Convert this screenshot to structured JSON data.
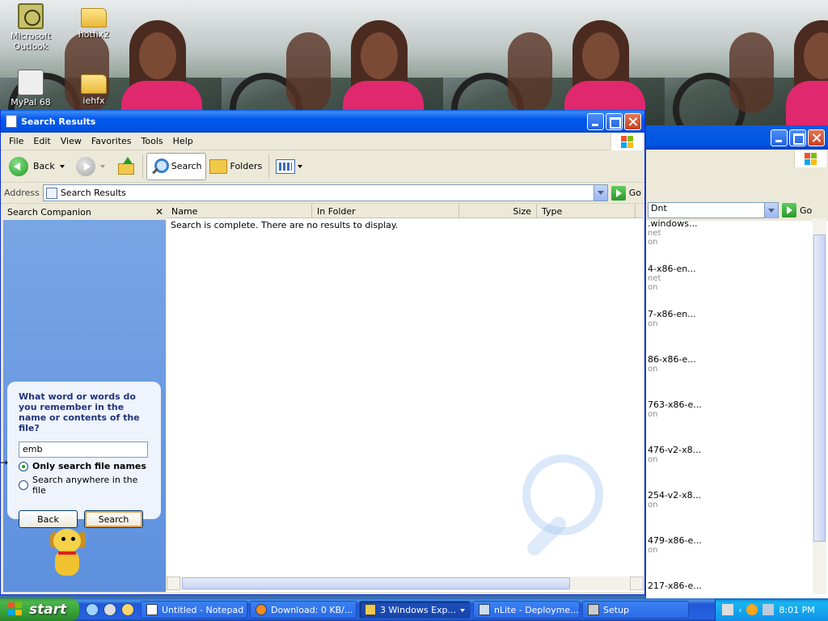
{
  "desktop": {
    "icons": [
      {
        "label": "Microsoft Outlook",
        "icon": "outlook-icon"
      },
      {
        "label": "hotfix2",
        "icon": "folder-icon"
      },
      {
        "label": "MyPal 68",
        "icon": "mypal-shortcut-icon"
      },
      {
        "label": "iehfx",
        "icon": "folder-icon"
      }
    ]
  },
  "window": {
    "title": "Search Results",
    "menu": [
      "File",
      "Edit",
      "View",
      "Favorites",
      "Tools",
      "Help"
    ],
    "toolbar": {
      "back_label": "Back",
      "search_label": "Search",
      "folders_label": "Folders"
    },
    "address": {
      "label": "Address",
      "value": "Search Results",
      "go_label": "Go"
    },
    "companion": {
      "title": "Search Companion",
      "question": "What word or words do you remember in the name or contents of the file?",
      "search_value": "emb",
      "option_1": "Only search file names",
      "option_2": "Search anywhere in the file",
      "back_label": "Back",
      "search_label": "Search"
    },
    "results": {
      "columns": [
        "Name",
        "In Folder",
        "Size",
        "Type"
      ],
      "message": "Search is complete. There are no results to display."
    }
  },
  "background_window": {
    "header_fragment": "Dnt",
    "go_label": "Go",
    "items": [
      {
        "name": ".windows...",
        "sub": "net",
        "sub2": "on"
      },
      {
        "name": "4-x86-en...",
        "sub": "net",
        "sub2": "on"
      },
      {
        "name": "7-x86-en...",
        "sub": "",
        "sub2": "on"
      },
      {
        "name": "86-x86-e...",
        "sub": "",
        "sub2": "on"
      },
      {
        "name": "763-x86-e...",
        "sub": "",
        "sub2": "on"
      },
      {
        "name": "476-v2-x8...",
        "sub": "",
        "sub2": "on"
      },
      {
        "name": "254-v2-x8...",
        "sub": "",
        "sub2": "on"
      },
      {
        "name": "479-x86-e...",
        "sub": "",
        "sub2": "on"
      },
      {
        "name": "217-x86-e...",
        "sub": "",
        "sub2": ""
      }
    ]
  },
  "taskbar": {
    "start_label": "start",
    "tasks": [
      {
        "label": "Untitled - Notepad",
        "active": false
      },
      {
        "label": "Download: 0 KB/...",
        "active": false
      },
      {
        "label": "3 Windows Exp...",
        "active": true
      },
      {
        "label": "nLite - Deployme...",
        "active": false
      },
      {
        "label": "Setup",
        "active": false
      }
    ],
    "clock": "8:01 PM"
  }
}
